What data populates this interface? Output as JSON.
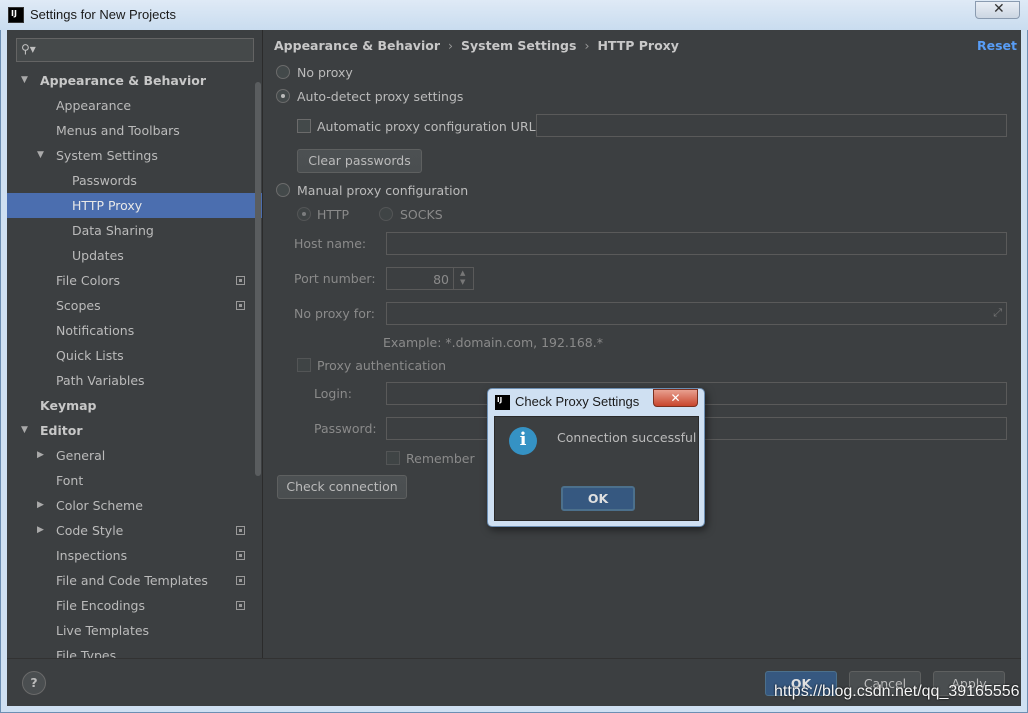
{
  "window": {
    "title": "Settings for New Projects",
    "close_glyph": "✕"
  },
  "sidebar": {
    "search_placeholder": "",
    "items": [
      {
        "label": "Appearance & Behavior",
        "level": 0,
        "bold": true,
        "expanded": true
      },
      {
        "label": "Appearance",
        "level": 1
      },
      {
        "label": "Menus and Toolbars",
        "level": 1
      },
      {
        "label": "System Settings",
        "level": 1,
        "expanded": true
      },
      {
        "label": "Passwords",
        "level": 2
      },
      {
        "label": "HTTP Proxy",
        "level": 2,
        "selected": true
      },
      {
        "label": "Data Sharing",
        "level": 2
      },
      {
        "label": "Updates",
        "level": 2
      },
      {
        "label": "File Colors",
        "level": 1,
        "project_icon": true
      },
      {
        "label": "Scopes",
        "level": 1,
        "project_icon": true
      },
      {
        "label": "Notifications",
        "level": 1
      },
      {
        "label": "Quick Lists",
        "level": 1
      },
      {
        "label": "Path Variables",
        "level": 1
      },
      {
        "label": "Keymap",
        "level": 0,
        "bold": true
      },
      {
        "label": "Editor",
        "level": 0,
        "bold": true,
        "expanded": true
      },
      {
        "label": "General",
        "level": 1,
        "collapsed": true
      },
      {
        "label": "Font",
        "level": 1
      },
      {
        "label": "Color Scheme",
        "level": 1,
        "collapsed": true
      },
      {
        "label": "Code Style",
        "level": 1,
        "collapsed": true,
        "project_icon": true
      },
      {
        "label": "Inspections",
        "level": 1,
        "project_icon": true
      },
      {
        "label": "File and Code Templates",
        "level": 1,
        "project_icon": true
      },
      {
        "label": "File Encodings",
        "level": 1,
        "project_icon": true
      },
      {
        "label": "Live Templates",
        "level": 1
      },
      {
        "label": "File Types",
        "level": 1
      }
    ]
  },
  "breadcrumb": [
    "Appearance & Behavior",
    "System Settings",
    "HTTP Proxy"
  ],
  "reset_label": "Reset",
  "proxy": {
    "no_proxy": "No proxy",
    "auto_detect": "Auto-detect proxy settings",
    "auto_config_url": "Automatic proxy configuration URL:",
    "auto_config_url_value": "",
    "clear_passwords": "Clear passwords",
    "manual": "Manual proxy configuration",
    "http": "HTTP",
    "socks": "SOCKS",
    "host_name": "Host name:",
    "host_value": "",
    "port_number": "Port number:",
    "port_value": "80",
    "no_proxy_for": "No proxy for:",
    "no_proxy_value": "",
    "example": "Example: *.domain.com, 192.168.*",
    "proxy_auth": "Proxy authentication",
    "login": "Login:",
    "password": "Password:",
    "remember": "Remember",
    "check_connection": "Check connection",
    "selected_mode": "auto-detect"
  },
  "footer": {
    "help": "?",
    "ok": "OK",
    "cancel": "Cancel",
    "apply": "Apply",
    "watermark": "https://blog.csdn.net/qq_39165556"
  },
  "dialog": {
    "title": "Check Proxy Settings",
    "close_glyph": "✕",
    "message": "Connection successful",
    "ok": "OK",
    "icon": "info-icon"
  },
  "colors": {
    "background": "#3c3f41",
    "selection": "#4b6eaf",
    "link": "#589df6",
    "primary_button": "#365880",
    "info": "#3592c4"
  }
}
